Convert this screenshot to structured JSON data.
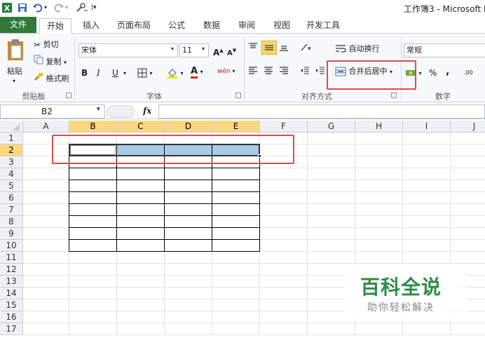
{
  "window": {
    "title": "工作簿3 - Microsoft E"
  },
  "ribbon_tabs": [
    "文件",
    "开始",
    "插入",
    "页面布局",
    "公式",
    "数据",
    "审阅",
    "视图",
    "开发工具"
  ],
  "clipboard": {
    "paste": "粘贴",
    "cut": "剪切",
    "copy": "复制",
    "format_painter": "格式刷",
    "label": "剪贴板"
  },
  "font": {
    "name": "宋体",
    "size": "11",
    "bold": "B",
    "italic": "I",
    "underline": "U",
    "grow": "A",
    "shrink": "A",
    "color_letter": "A",
    "phonetic": "wén",
    "label": "字体"
  },
  "alignment": {
    "wrap_text": "自动换行",
    "merge_center": "合并后居中",
    "label": "对齐方式"
  },
  "number": {
    "format": "常规",
    "percent": "%",
    "comma": ",",
    "label": "数字",
    "decimals": ".00"
  },
  "formula_bar": {
    "name_box": "B2",
    "fx": "fx",
    "value": ""
  },
  "grid": {
    "columns": [
      "A",
      "B",
      "C",
      "D",
      "E",
      "F",
      "G",
      "H",
      "I",
      "J"
    ],
    "rows": [
      "1",
      "2",
      "3",
      "4",
      "5",
      "6",
      "7",
      "8",
      "9",
      "10",
      "11",
      "12",
      "13",
      "14",
      "15",
      "16",
      "17"
    ],
    "selected_columns": [
      "B",
      "C",
      "D",
      "E"
    ],
    "selected_row": "2"
  },
  "watermark": {
    "title": "百科全说",
    "subtitle": "助你轻松解决"
  },
  "colors": {
    "file_tab": "#2f7a3a",
    "selection": "#a8c9e8",
    "header_highlight": "#f9d77e",
    "highlight_box": "#e0494c",
    "watermark": "#2e8b47"
  }
}
